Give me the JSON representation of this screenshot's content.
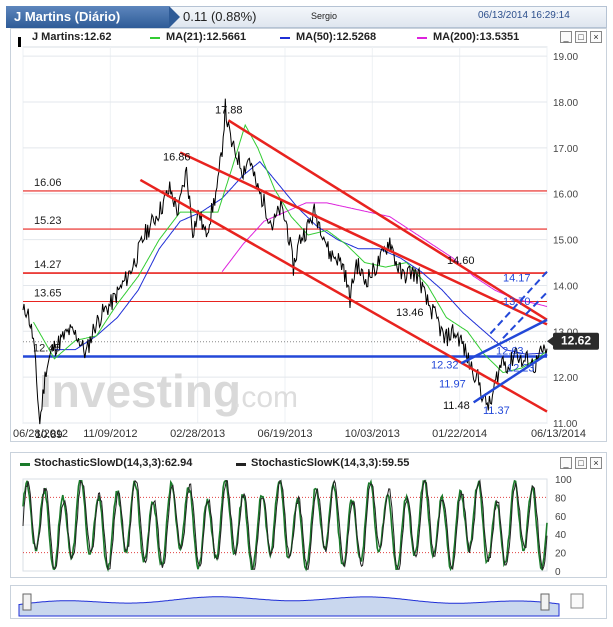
{
  "header": {
    "title": "J Martins (Diário)",
    "change": "0.11 (0.88%)",
    "exchange": "Sergio",
    "datetime": "06/13/2014 16:29:14"
  },
  "main_legend": {
    "price": "J Martins:12.62",
    "ma21": "MA(21):12.5661",
    "ma50": "MA(50):12.5268",
    "ma200": "MA(200):13.5351"
  },
  "stoch_legend": {
    "d": "StochasticSlowD(14,3,3):62.94",
    "k": "StochasticSlowK(14,3,3):59.55"
  },
  "watermark": {
    "brand": "Investing",
    "suffix": ".com"
  },
  "colors": {
    "price": "#000000",
    "ma21": "#33cc33",
    "ma50": "#1f2fd6",
    "ma200": "#dd22dd",
    "red": "#e8231f",
    "blue": "#2348d8",
    "stoch_d": "#1a7a2a",
    "stoch_k": "#222222"
  },
  "chart_data": [
    {
      "type": "line",
      "x_dates": [
        "06/28/2012",
        "11/09/2012",
        "02/28/2013",
        "06/19/2013",
        "10/03/2013",
        "01/22/2014",
        "06/13/2014"
      ],
      "ylim": [
        11.0,
        19.2
      ],
      "y_ticks": [
        "19.00",
        "18.00",
        "17.00",
        "16.00",
        "15.00",
        "14.00",
        "13.00",
        "12.00",
        "11.00"
      ],
      "last_price_label": "12.62",
      "horizontal_levels": [
        {
          "label": "16.06",
          "value": 16.06
        },
        {
          "label": "15.23",
          "value": 15.23
        },
        {
          "label": "14.27",
          "value": 14.27
        },
        {
          "label": "13.65",
          "value": 13.65
        },
        {
          "label": "12.45",
          "value": 12.45
        }
      ],
      "annotations": [
        {
          "label": "17.88",
          "color": "black"
        },
        {
          "label": "16.86",
          "color": "black"
        },
        {
          "label": "14.60",
          "color": "black"
        },
        {
          "label": "13.46",
          "color": "black"
        },
        {
          "label": "10.89",
          "color": "black"
        },
        {
          "label": "11.48",
          "color": "black"
        },
        {
          "label": "14.17",
          "color": "blue"
        },
        {
          "label": "13.70",
          "color": "blue"
        },
        {
          "label": "12.32",
          "color": "blue"
        },
        {
          "label": "11.97",
          "color": "blue"
        },
        {
          "label": "11.37",
          "color": "blue"
        },
        {
          "label": "12.63",
          "color": "blue"
        },
        {
          "label": "12.23",
          "color": "blue"
        }
      ],
      "price_anchors": [
        [
          0,
          13.4
        ],
        [
          4,
          13.5
        ],
        [
          10,
          12.8
        ],
        [
          16,
          11.0
        ],
        [
          22,
          12.2
        ],
        [
          28,
          12.6
        ],
        [
          36,
          12.8
        ],
        [
          44,
          13.0
        ],
        [
          52,
          12.9
        ],
        [
          60,
          12.5
        ],
        [
          68,
          13.1
        ],
        [
          76,
          13.4
        ],
        [
          84,
          13.6
        ],
        [
          92,
          13.9
        ],
        [
          100,
          14.2
        ],
        [
          108,
          14.6
        ],
        [
          116,
          15.1
        ],
        [
          124,
          15.4
        ],
        [
          132,
          15.7
        ],
        [
          140,
          16.1
        ],
        [
          148,
          15.6
        ],
        [
          156,
          16.5
        ],
        [
          162,
          15.2
        ],
        [
          168,
          15.6
        ],
        [
          174,
          15.1
        ],
        [
          180,
          15.6
        ],
        [
          186,
          16.2
        ],
        [
          190,
          17.0
        ],
        [
          193,
          17.88
        ],
        [
          196,
          17.4
        ],
        [
          200,
          17.0
        ],
        [
          205,
          16.8
        ],
        [
          210,
          16.5
        ],
        [
          216,
          16.8
        ],
        [
          222,
          16.2
        ],
        [
          230,
          15.8
        ],
        [
          238,
          15.3
        ],
        [
          246,
          15.7
        ],
        [
          252,
          15.3
        ],
        [
          258,
          14.4
        ],
        [
          264,
          15.0
        ],
        [
          270,
          15.2
        ],
        [
          278,
          15.6
        ],
        [
          286,
          15.2
        ],
        [
          292,
          14.7
        ],
        [
          300,
          14.6
        ],
        [
          306,
          14.4
        ],
        [
          312,
          13.7
        ],
        [
          318,
          14.5
        ],
        [
          326,
          14.1
        ],
        [
          334,
          14.3
        ],
        [
          342,
          14.6
        ],
        [
          350,
          15.0
        ],
        [
          356,
          14.5
        ],
        [
          362,
          14.2
        ],
        [
          370,
          14.3
        ],
        [
          378,
          14.2
        ],
        [
          384,
          13.7
        ],
        [
          390,
          13.46
        ],
        [
          396,
          13.2
        ],
        [
          402,
          12.8
        ],
        [
          410,
          13.0
        ],
        [
          418,
          12.8
        ],
        [
          426,
          12.3
        ],
        [
          434,
          11.97
        ],
        [
          440,
          11.48
        ],
        [
          446,
          11.37
        ],
        [
          452,
          12.0
        ],
        [
          458,
          12.4
        ],
        [
          464,
          12.2
        ],
        [
          470,
          12.63
        ],
        [
          476,
          12.3
        ],
        [
          482,
          12.4
        ],
        [
          488,
          12.23
        ],
        [
          494,
          12.5
        ],
        [
          500,
          12.62
        ]
      ],
      "ma21_anchors": [
        [
          10,
          13.2
        ],
        [
          30,
          12.4
        ],
        [
          50,
          12.8
        ],
        [
          70,
          12.9
        ],
        [
          90,
          13.6
        ],
        [
          110,
          14.2
        ],
        [
          130,
          15.0
        ],
        [
          150,
          15.6
        ],
        [
          170,
          15.6
        ],
        [
          186,
          15.6
        ],
        [
          200,
          16.6
        ],
        [
          212,
          17.5
        ],
        [
          224,
          17.0
        ],
        [
          240,
          16.1
        ],
        [
          256,
          15.5
        ],
        [
          272,
          15.1
        ],
        [
          290,
          15.2
        ],
        [
          308,
          14.9
        ],
        [
          326,
          14.5
        ],
        [
          346,
          14.4
        ],
        [
          366,
          14.5
        ],
        [
          386,
          14.0
        ],
        [
          404,
          13.3
        ],
        [
          424,
          13.0
        ],
        [
          440,
          12.5
        ],
        [
          458,
          12.1
        ],
        [
          476,
          12.2
        ],
        [
          490,
          12.4
        ],
        [
          500,
          12.57
        ]
      ],
      "ma50_anchors": [
        [
          30,
          12.6
        ],
        [
          50,
          12.6
        ],
        [
          70,
          12.9
        ],
        [
          90,
          13.3
        ],
        [
          110,
          13.9
        ],
        [
          130,
          14.8
        ],
        [
          150,
          15.4
        ],
        [
          170,
          15.6
        ],
        [
          190,
          15.9
        ],
        [
          210,
          16.4
        ],
        [
          226,
          16.7
        ],
        [
          244,
          16.2
        ],
        [
          262,
          15.7
        ],
        [
          280,
          15.3
        ],
        [
          300,
          15.0
        ],
        [
          320,
          14.8
        ],
        [
          340,
          14.8
        ],
        [
          360,
          14.6
        ],
        [
          380,
          14.3
        ],
        [
          400,
          13.9
        ],
        [
          420,
          13.4
        ],
        [
          440,
          13.0
        ],
        [
          460,
          12.6
        ],
        [
          480,
          12.5
        ],
        [
          500,
          12.53
        ]
      ],
      "ma200_anchors": [
        [
          190,
          14.3
        ],
        [
          210,
          14.9
        ],
        [
          230,
          15.4
        ],
        [
          250,
          15.6
        ],
        [
          270,
          15.8
        ],
        [
          290,
          15.8
        ],
        [
          310,
          15.7
        ],
        [
          330,
          15.6
        ],
        [
          350,
          15.5
        ],
        [
          370,
          15.2
        ],
        [
          390,
          14.9
        ],
        [
          410,
          14.6
        ],
        [
          430,
          14.2
        ],
        [
          450,
          13.9
        ],
        [
          470,
          13.7
        ],
        [
          490,
          13.6
        ],
        [
          500,
          13.54
        ]
      ]
    },
    {
      "type": "line",
      "series": [
        {
          "name": "StochasticSlowD(14,3,3)",
          "last": 62.94
        },
        {
          "name": "StochasticSlowK(14,3,3)",
          "last": 59.55
        }
      ],
      "ylim": [
        0,
        100
      ],
      "y_ticks": [
        "100",
        "80",
        "60",
        "40",
        "20",
        "0"
      ]
    }
  ]
}
